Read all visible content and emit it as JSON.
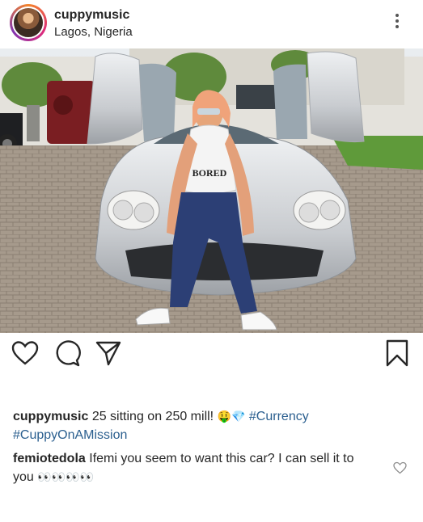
{
  "post": {
    "username": "cuppymusic",
    "location": "Lagos, Nigeria",
    "shirt_text": "BORED"
  },
  "caption": {
    "username": "cuppymusic",
    "text": "25 sitting on 250 mill!",
    "emojis": "🤑💎",
    "hashtag1": "#Currency",
    "hashtag2": "#CuppyOnAMission"
  },
  "comment": {
    "username": "femiotedola",
    "text": "Ifemi you seem to want this car? I can sell it to you",
    "emojis": "👀👀👀👀"
  },
  "icons": {
    "like": "heart-icon",
    "comment": "comment-icon",
    "share": "send-icon",
    "save": "bookmark-icon",
    "more": "more-vertical-icon",
    "comment_like": "heart-icon"
  }
}
